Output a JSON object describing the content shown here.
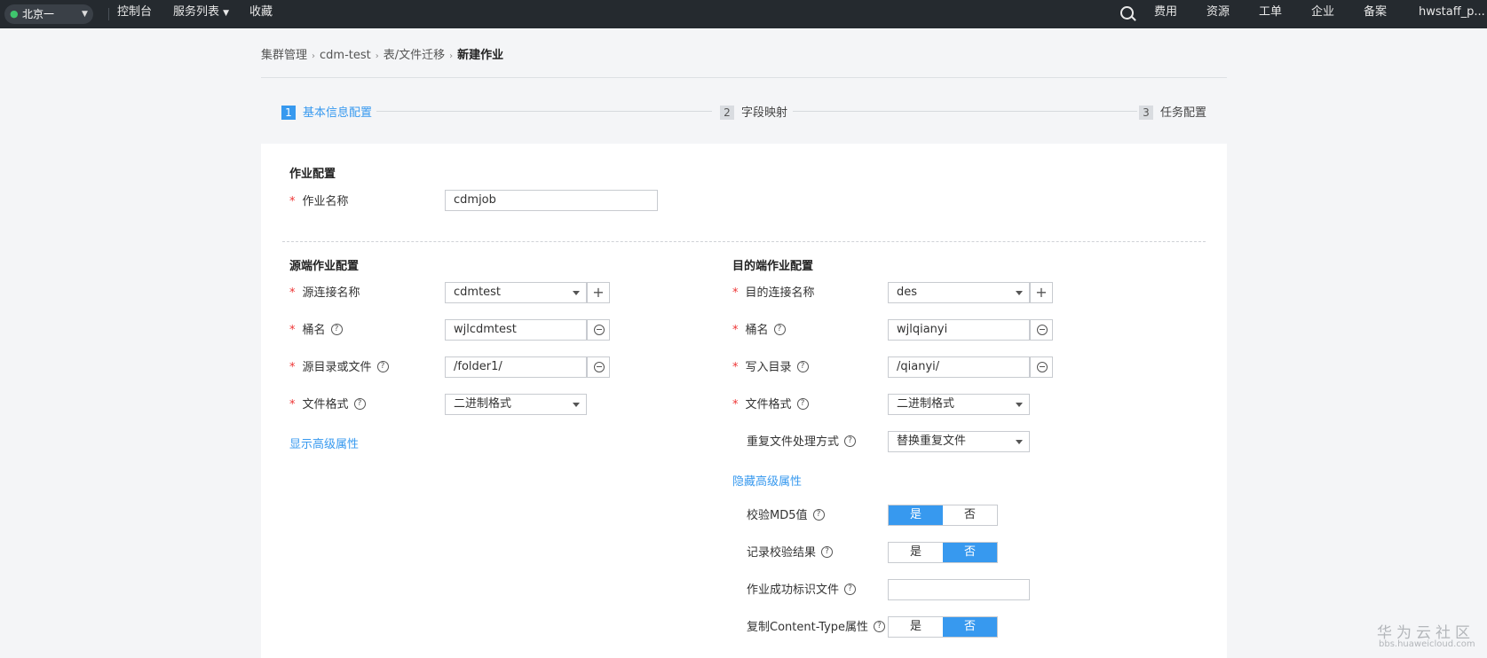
{
  "topbar": {
    "region": "北京一",
    "nav": [
      "控制台",
      "服务列表",
      "收藏"
    ],
    "right": [
      "费用",
      "资源",
      "工单",
      "企业",
      "备案",
      "hwstaff_p..."
    ]
  },
  "breadcrumb": [
    "集群管理",
    "cdm-test",
    "表/文件迁移",
    "新建作业"
  ],
  "steps": [
    {
      "num": "1",
      "label": "基本信息配置"
    },
    {
      "num": "2",
      "label": "字段映射"
    },
    {
      "num": "3",
      "label": "任务配置"
    }
  ],
  "job": {
    "section": "作业配置",
    "name_label": "作业名称",
    "name_value": "cdmjob"
  },
  "source": {
    "section": "源端作业配置",
    "conn_label": "源连接名称",
    "conn_value": "cdmtest",
    "bucket_label": "桶名",
    "bucket_value": "wjlcdmtest",
    "dir_label": "源目录或文件",
    "dir_value": "/folder1/",
    "format_label": "文件格式",
    "format_value": "二进制格式",
    "advanced_link": "显示高级属性"
  },
  "dest": {
    "section": "目的端作业配置",
    "conn_label": "目的连接名称",
    "conn_value": "des",
    "bucket_label": "桶名",
    "bucket_value": "wjlqianyi",
    "dir_label": "写入目录",
    "dir_value": "/qianyi/",
    "format_label": "文件格式",
    "format_value": "二进制格式",
    "dup_label": "重复文件处理方式",
    "dup_value": "替换重复文件",
    "advanced_link": "隐藏高级属性",
    "md5_label": "校验MD5值",
    "md5_value": "是",
    "record_label": "记录校验结果",
    "record_value": "否",
    "flag_label": "作业成功标识文件",
    "flag_value": "",
    "ctype_label": "复制Content-Type属性",
    "ctype_value": "否",
    "yes": "是",
    "no": "否"
  },
  "watermark": {
    "title": "华为云社区",
    "url": "bbs.huaweicloud.com"
  },
  "colors": {
    "accent": "#3799ef",
    "topbar": "#252a2f",
    "required": "#ee3333"
  }
}
